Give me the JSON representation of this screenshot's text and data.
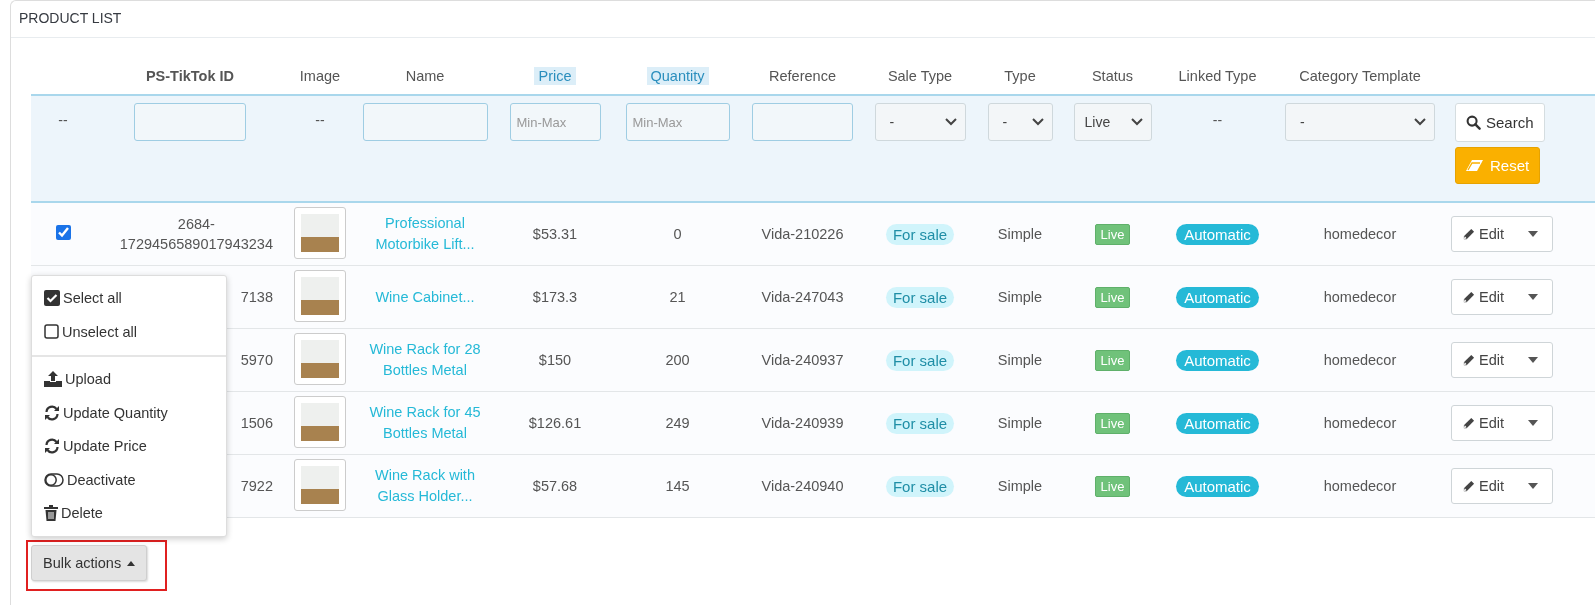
{
  "panel": {
    "title": "PRODUCT LIST"
  },
  "table": {
    "columns": [
      {
        "label": "PS-TikTok ID",
        "highlighted": false
      },
      {
        "label": "Image",
        "highlighted": false
      },
      {
        "label": "Name",
        "highlighted": false
      },
      {
        "label": "Price",
        "highlighted": true
      },
      {
        "label": "Quantity",
        "highlighted": true
      },
      {
        "label": "Reference",
        "highlighted": false
      },
      {
        "label": "Sale Type",
        "highlighted": false
      },
      {
        "label": "Type",
        "highlighted": false
      },
      {
        "label": "Status",
        "highlighted": false
      },
      {
        "label": "Linked Type",
        "highlighted": false
      },
      {
        "label": "Category Template",
        "highlighted": false
      }
    ],
    "filters": [
      {
        "kind": "dash",
        "text": "--"
      },
      {
        "kind": "input"
      },
      {
        "kind": "dash",
        "text": "--"
      },
      {
        "kind": "input"
      },
      {
        "kind": "input",
        "placeholder": "Min-Max"
      },
      {
        "kind": "input",
        "placeholder": "Min-Max"
      },
      {
        "kind": "input"
      },
      {
        "kind": "select",
        "value": "-"
      },
      {
        "kind": "select",
        "value": "-"
      },
      {
        "kind": "select",
        "value": "Live"
      },
      {
        "kind": "dash",
        "text": "--"
      },
      {
        "kind": "select",
        "value": "-"
      },
      {
        "kind": "buttons",
        "search": "Search",
        "reset": "Reset"
      }
    ],
    "rows": [
      {
        "checkbox": {
          "checked": true
        },
        "id": [
          "2684-",
          "1729456589017943234"
        ],
        "name": "Professional Motorbike Lift...",
        "price": "$53.31",
        "quantity": "0",
        "reference": "Vida-210226",
        "sale_type": "For sale",
        "type": "Simple",
        "status": "Live",
        "linked_type": "Automatic",
        "category": "homedecor",
        "action": "Edit"
      },
      {
        "id": [
          "7138"
        ],
        "name": "Wine Cabinet...",
        "price": "$173.3",
        "quantity": "21",
        "reference": "Vida-247043",
        "sale_type": "For sale",
        "type": "Simple",
        "status": "Live",
        "linked_type": "Automatic",
        "category": "homedecor",
        "action": "Edit"
      },
      {
        "id": [
          "5970"
        ],
        "name": "Wine Rack for 28 Bottles Metal",
        "price": "$150",
        "quantity": "200",
        "reference": "Vida-240937",
        "sale_type": "For sale",
        "type": "Simple",
        "status": "Live",
        "linked_type": "Automatic",
        "category": "homedecor",
        "action": "Edit"
      },
      {
        "id": [
          "1506"
        ],
        "name": "Wine Rack for 45 Bottles Metal",
        "price": "$126.61",
        "quantity": "249",
        "reference": "Vida-240939",
        "sale_type": "For sale",
        "type": "Simple",
        "status": "Live",
        "linked_type": "Automatic",
        "category": "homedecor",
        "action": "Edit"
      },
      {
        "id": [
          "7922"
        ],
        "name": "Wine Rack with Glass Holder...",
        "price": "$57.68",
        "quantity": "145",
        "reference": "Vida-240940",
        "sale_type": "For sale",
        "type": "Simple",
        "status": "Live",
        "linked_type": "Automatic",
        "category": "homedecor",
        "action": "Edit"
      }
    ]
  },
  "bulk_actions": {
    "label": "Bulk actions",
    "expanded": true,
    "highlighted": true,
    "menu": [
      [
        {
          "kind": "check",
          "label": "Select all"
        },
        {
          "kind": "uncheck",
          "label": "Unselect all"
        }
      ],
      [
        {
          "kind": "upload",
          "label": "Upload"
        },
        {
          "kind": "refresh",
          "label": "Update Quantity"
        },
        {
          "kind": "refresh",
          "label": "Update Price"
        },
        {
          "kind": "toggle",
          "label": "Deactivate"
        },
        {
          "kind": "trash",
          "label": "Delete"
        }
      ]
    ]
  }
}
